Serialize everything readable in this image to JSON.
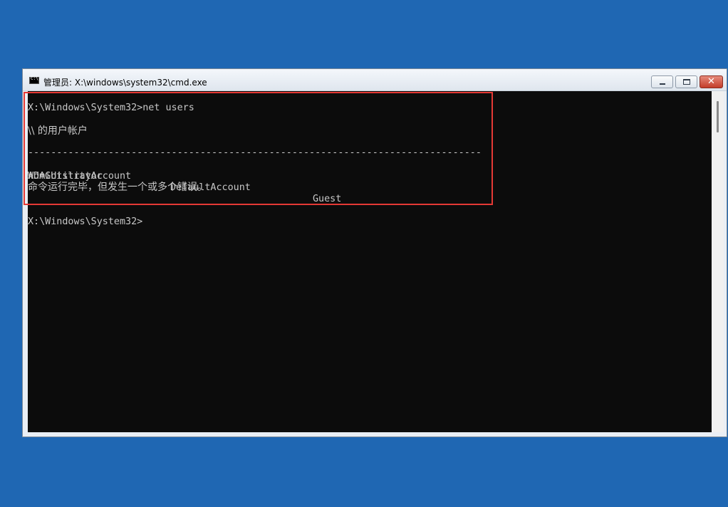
{
  "window": {
    "title": "管理员: X:\\windows\\system32\\cmd.exe",
    "icon": "cmd-icon"
  },
  "titlebar_buttons": {
    "minimize_icon": "minimize-icon",
    "maximize_icon": "restore-icon",
    "close_icon": "close-icon",
    "close_glyph": "✕"
  },
  "console": {
    "command_line": "X:\\Windows\\System32>net users",
    "accounts_header": "\\\\ 的用户帐户",
    "separator": "-------------------------------------------------------------------------------",
    "accounts": [
      "Administrator",
      "DefaultAccount",
      "Guest",
      "WDAGUtilityAccount"
    ],
    "status_message": "命令运行完毕，但发生一个或多个错误。",
    "prompt": "X:\\Windows\\System32>"
  },
  "colors": {
    "desktop": "#1f67b3",
    "console_bg": "#0c0c0c",
    "console_text": "#c7c7c7",
    "highlight": "#e53935"
  }
}
